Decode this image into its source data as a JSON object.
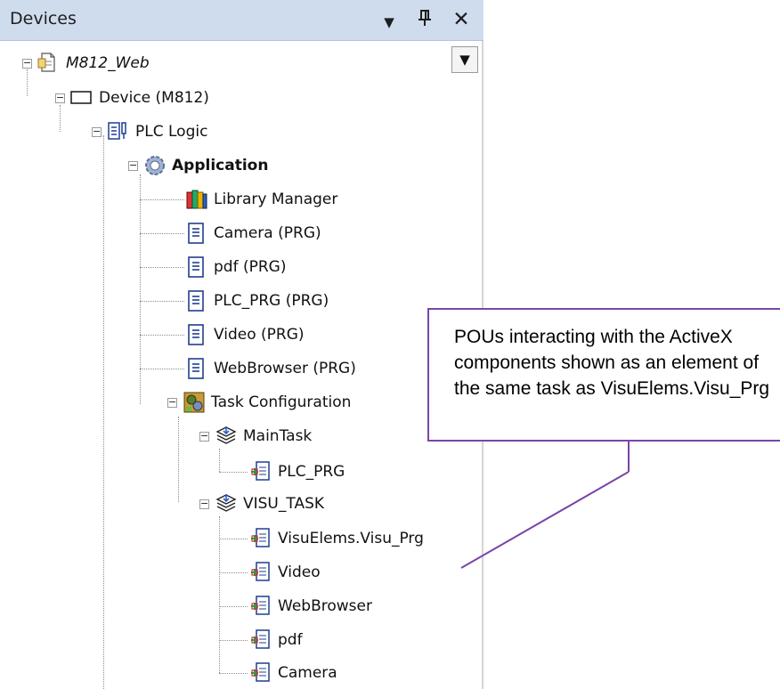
{
  "panel": {
    "title": "Devices",
    "dropdown_icon": "▼",
    "pin_icon": "ᵽ",
    "close_icon": "✕",
    "scroll_dropdown_icon": "▼"
  },
  "tree": {
    "root": "M812_Web",
    "device": "Device (M812)",
    "plc_logic": "PLC Logic",
    "application": "Application",
    "library_manager": "Library Manager",
    "pous": [
      "Camera (PRG)",
      "pdf (PRG)",
      "PLC_PRG (PRG)",
      "Video (PRG)",
      "WebBrowser (PRG)"
    ],
    "task_configuration": "Task Configuration",
    "main_task": "MainTask",
    "main_task_items": [
      "PLC_PRG"
    ],
    "visu_task": "VISU_TASK",
    "visu_task_items": [
      "VisuElems.Visu_Prg",
      "Video",
      "WebBrowser",
      "pdf",
      "Camera"
    ],
    "expander_symbol": "−"
  },
  "annotation": {
    "text": "POUs interacting with the ActiveX components shown as an element of the same task as VisuElems.Visu_Prg",
    "border_color": "#7a45a8"
  },
  "colors": {
    "header_bg": "#cfdcee",
    "callout_border": "#7a45a8"
  }
}
